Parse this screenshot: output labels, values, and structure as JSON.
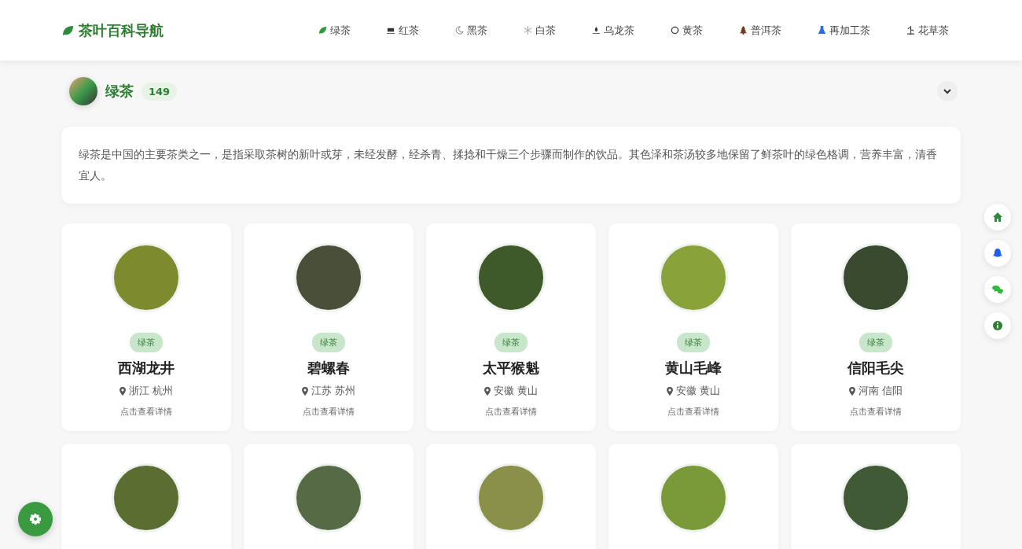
{
  "header": {
    "logo": "茶叶百科导航"
  },
  "nav": [
    {
      "kind": "leaf",
      "label": "绿茶"
    },
    {
      "kind": "cup",
      "label": "红茶"
    },
    {
      "kind": "moon",
      "label": "黑茶"
    },
    {
      "kind": "snow",
      "label": "白茶"
    },
    {
      "kind": "drop",
      "label": "乌龙茶"
    },
    {
      "kind": "ring",
      "label": "黄茶"
    },
    {
      "kind": "tree",
      "label": "普洱茶"
    },
    {
      "kind": "flask",
      "label": "再加工茶"
    },
    {
      "kind": "herb",
      "label": "花草茶"
    }
  ],
  "section": {
    "title": "绿茶",
    "count": "149",
    "expanded": true,
    "description": "绿茶是中国的主要茶类之一，是指采取茶树的新叶或芽，未经发酵，经杀青、揉捻和干燥三个步骤而制作的饮品。其色泽和茶汤较多地保留了鲜茶叶的绿色格调，营养丰富，清香宜人。"
  },
  "cards": [
    {
      "kind": "full",
      "tag": "绿茶",
      "name": "西湖龙井",
      "origin": "浙江 杭州",
      "hint": "点击查看详情"
    },
    {
      "kind": "full",
      "tag": "绿茶",
      "name": "碧螺春",
      "origin": "江苏 苏州",
      "hint": "点击查看详情"
    },
    {
      "kind": "full",
      "tag": "绿茶",
      "name": "太平猴魁",
      "origin": "安徽 黄山",
      "hint": "点击查看详情"
    },
    {
      "kind": "full",
      "tag": "绿茶",
      "name": "黄山毛峰",
      "origin": "安徽 黄山",
      "hint": "点击查看详情"
    },
    {
      "kind": "full",
      "tag": "绿茶",
      "name": "信阳毛尖",
      "origin": "河南 信阳",
      "hint": "点击查看详情"
    },
    {
      "kind": "image"
    },
    {
      "kind": "image"
    },
    {
      "kind": "image"
    },
    {
      "kind": "image"
    },
    {
      "kind": "image"
    }
  ],
  "side_buttons": [
    {
      "kind": "home"
    },
    {
      "kind": "qq"
    },
    {
      "kind": "wechat"
    },
    {
      "kind": "info"
    }
  ]
}
